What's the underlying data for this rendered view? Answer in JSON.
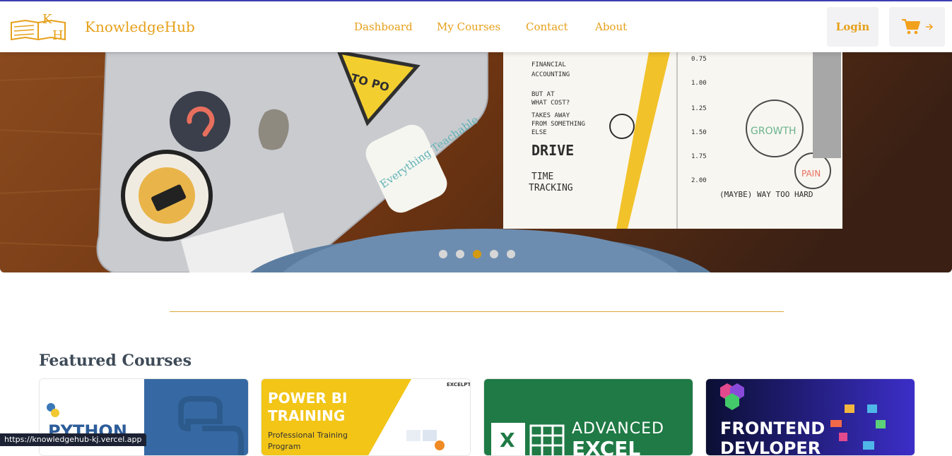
{
  "header": {
    "brand": "KnowledgeHub",
    "logo_letters": "KH",
    "nav": [
      "Dashboard",
      "My Courses",
      "Contact",
      "About"
    ],
    "login_label": "Login",
    "cart_icon": "cart-icon",
    "arrow_icon": "arrow-right-icon"
  },
  "hero": {
    "slide_count": 5,
    "active_slide": 3
  },
  "featured": {
    "title": "Featured Courses",
    "cards": [
      {
        "label": "PYTHON"
      },
      {
        "label": "POWER BI TRAINING",
        "line1": "POWER BI",
        "line2": "TRAINING",
        "sub": "Professional Training",
        "sub2": "Program",
        "brand": "EXCELPTP"
      },
      {
        "label": "ADVANCED EXCEL",
        "line1": "ADVANCED",
        "line2": "EXCEL"
      },
      {
        "label": "FRONTEND DEVLOPER",
        "line1": "FRONTEND",
        "line2": "DEVLOPER"
      }
    ]
  },
  "status_url": "https://knowledgehub-kj.vercel.app",
  "colors": {
    "accent": "#e6a01a",
    "dot_active": "#d39a12",
    "title": "#3e4a57"
  }
}
